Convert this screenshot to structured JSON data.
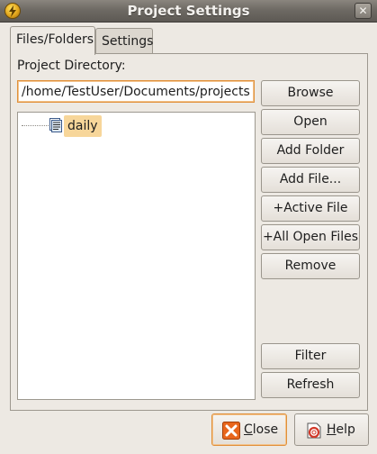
{
  "window": {
    "title": "Project Settings",
    "close_glyph": "✕"
  },
  "tabs": [
    {
      "label": "Files/Folders",
      "active": true
    },
    {
      "label": "Settings",
      "active": false
    }
  ],
  "project": {
    "directory_label": "Project Directory:",
    "directory_value": "/home/TestUser/Documents/projects"
  },
  "tree": {
    "items": [
      {
        "label": "daily",
        "icon": "project-file-icon",
        "selected": true
      }
    ]
  },
  "side_buttons": {
    "browse": "Browse",
    "open": "Open",
    "add_folder": "Add Folder",
    "add_file": "Add File...",
    "active_file": "+Active File",
    "all_open_files": "+All Open Files",
    "remove": "Remove",
    "filter": "Filter",
    "refresh": "Refresh"
  },
  "bottom_buttons": {
    "close": {
      "mnemonic": "C",
      "rest": "lose",
      "icon": "close-x-icon"
    },
    "help": {
      "mnemonic": "H",
      "rest": "elp",
      "icon": "help-icon"
    }
  },
  "colors": {
    "focus_border": "#e0903a",
    "selection": "#f7d69a",
    "titlebar": "#6e6a64",
    "close_icon": "#e8661c"
  }
}
